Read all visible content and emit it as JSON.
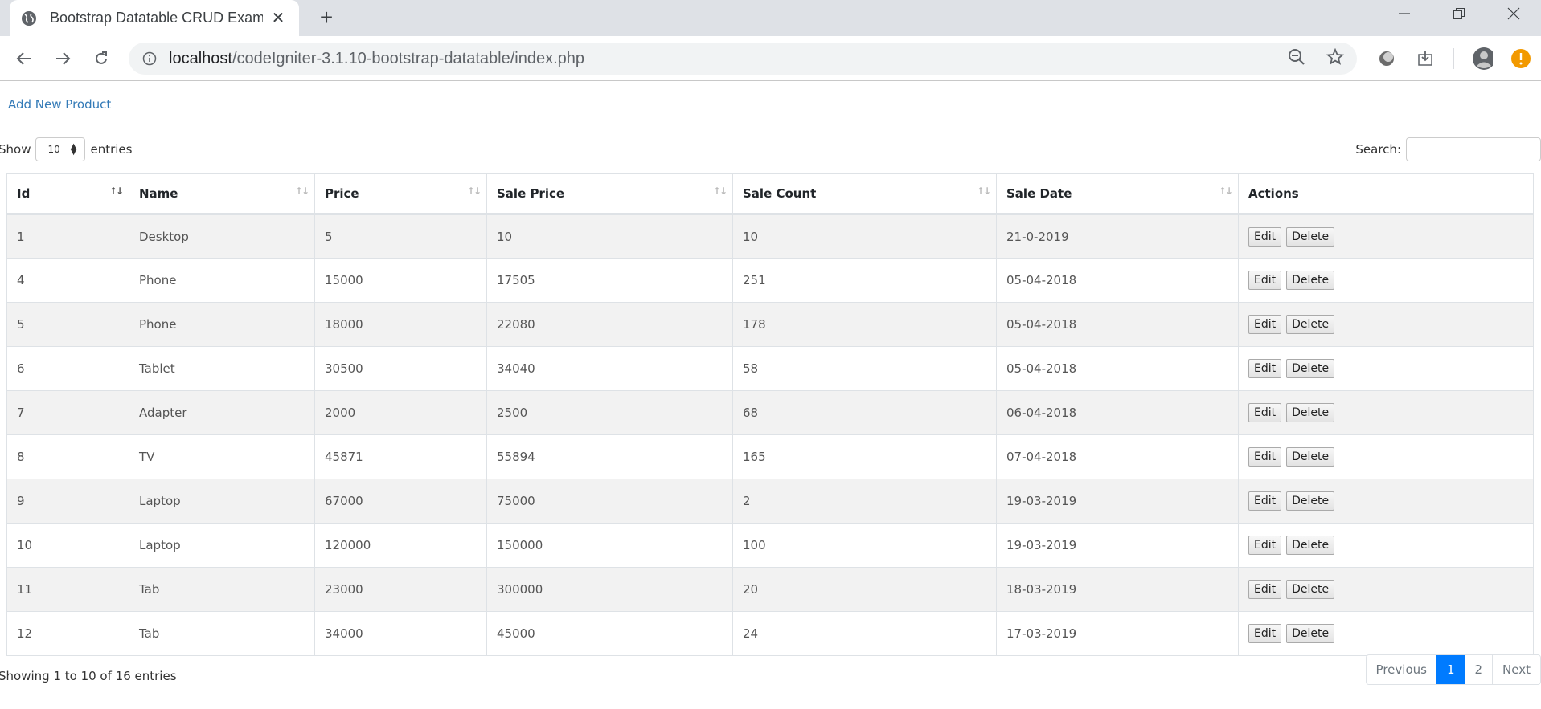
{
  "browser": {
    "tab_title": "Bootstrap Datatable CRUD Example",
    "url_host": "localhost",
    "url_path": "/codeIgniter-3.1.10-bootstrap-datatable/index.php"
  },
  "page": {
    "add_link": "Add New Product",
    "length": {
      "prefix": "Show",
      "value": "10",
      "suffix": "entries"
    },
    "search": {
      "label": "Search:",
      "value": "",
      "placeholder": ""
    },
    "table": {
      "columns": [
        "Id",
        "Name",
        "Price",
        "Sale Price",
        "Sale Count",
        "Sale Date",
        "Actions"
      ],
      "rows": [
        {
          "id": "1",
          "name": "Desktop",
          "price": "5",
          "sale_price": "10",
          "sale_count": "10",
          "sale_date": "21-0-2019"
        },
        {
          "id": "4",
          "name": "Phone",
          "price": "15000",
          "sale_price": "17505",
          "sale_count": "251",
          "sale_date": "05-04-2018"
        },
        {
          "id": "5",
          "name": "Phone",
          "price": "18000",
          "sale_price": "22080",
          "sale_count": "178",
          "sale_date": "05-04-2018"
        },
        {
          "id": "6",
          "name": "Tablet",
          "price": "30500",
          "sale_price": "34040",
          "sale_count": "58",
          "sale_date": "05-04-2018"
        },
        {
          "id": "7",
          "name": "Adapter",
          "price": "2000",
          "sale_price": "2500",
          "sale_count": "68",
          "sale_date": "06-04-2018"
        },
        {
          "id": "8",
          "name": "TV",
          "price": "45871",
          "sale_price": "55894",
          "sale_count": "165",
          "sale_date": "07-04-2018"
        },
        {
          "id": "9",
          "name": "Laptop",
          "price": "67000",
          "sale_price": "75000",
          "sale_count": "2",
          "sale_date": "19-03-2019"
        },
        {
          "id": "10",
          "name": "Laptop",
          "price": "120000",
          "sale_price": "150000",
          "sale_count": "100",
          "sale_date": "19-03-2019"
        },
        {
          "id": "11",
          "name": "Tab",
          "price": "23000",
          "sale_price": "300000",
          "sale_count": "20",
          "sale_date": "18-03-2019"
        },
        {
          "id": "12",
          "name": "Tab",
          "price": "34000",
          "sale_price": "45000",
          "sale_count": "24",
          "sale_date": "17-03-2019"
        }
      ],
      "edit_label": "Edit",
      "delete_label": "Delete"
    },
    "info": "Showing 1 to 10 of 16 entries",
    "pagination": {
      "previous": "Previous",
      "pages": [
        "1",
        "2"
      ],
      "current": "1",
      "next": "Next"
    }
  },
  "colors": {
    "link": "#337ab7",
    "active_page": "#007bff",
    "badge": "#f29900"
  }
}
